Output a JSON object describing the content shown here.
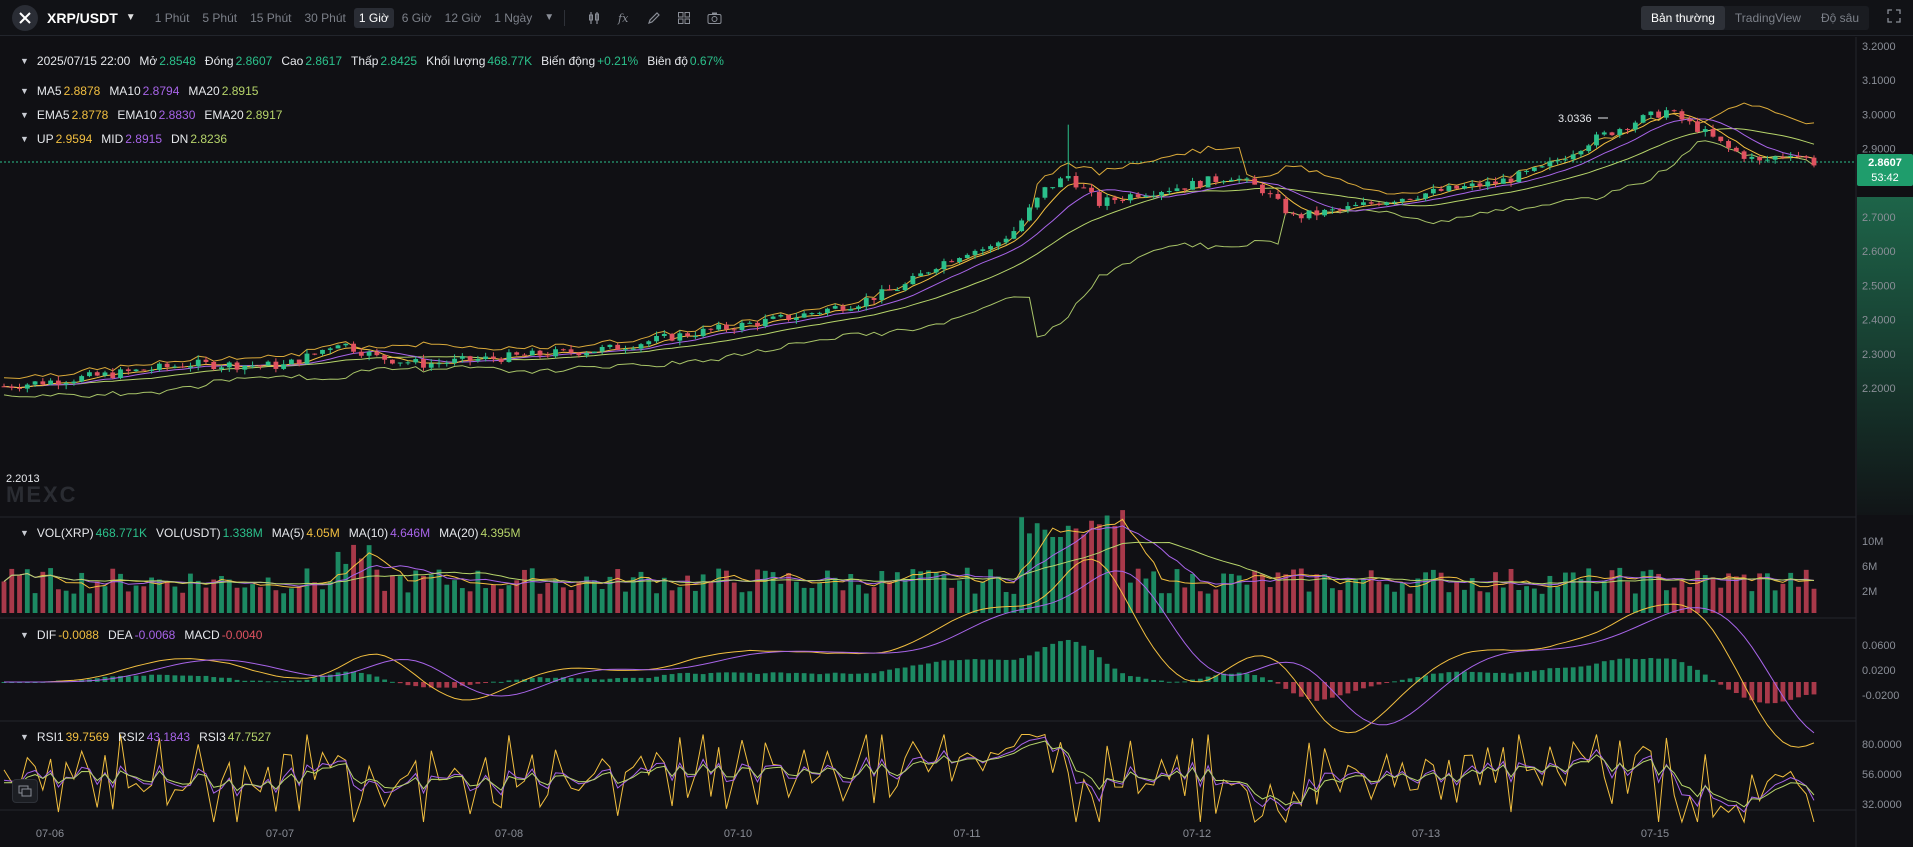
{
  "toolbar": {
    "symbol": "XRP/USDT",
    "intervals": [
      "1 Phút",
      "5 Phút",
      "15 Phút",
      "30 Phút",
      "1 Giờ",
      "6 Giờ",
      "12 Giờ",
      "1 Ngày"
    ],
    "active_interval": "1 Giờ",
    "views": [
      "Bản thường",
      "TradingView",
      "Độ sâu"
    ],
    "active_view": "Bản thường"
  },
  "ohlc": {
    "date": "2025/07/15 22:00",
    "open_label": "Mở",
    "open": "2.8548",
    "close_label": "Đóng",
    "close": "2.8607",
    "high_label": "Cao",
    "high": "2.8617",
    "low_label": "Thấp",
    "low": "2.8425",
    "volume_label": "Khối lượng",
    "volume": "468.77K",
    "change_label": "Biến động",
    "change": "+0.21%",
    "amplitude_label": "Biên độ",
    "amplitude": "0.67%"
  },
  "ma": {
    "ma5_label": "MA5",
    "ma5": "2.8878",
    "ma10_label": "MA10",
    "ma10": "2.8794",
    "ma20_label": "MA20",
    "ma20": "2.8915"
  },
  "ema": {
    "ema5_label": "EMA5",
    "ema5": "2.8778",
    "ema10_label": "EMA10",
    "ema10": "2.8830",
    "ema20_label": "EMA20",
    "ema20": "2.8917"
  },
  "boll": {
    "up_label": "UP",
    "up": "2.9594",
    "mid_label": "MID",
    "mid": "2.8915",
    "dn_label": "DN",
    "dn": "2.8236"
  },
  "vol": {
    "xrp_label": "VOL(XRP)",
    "xrp": "468.771K",
    "usdt_label": "VOL(USDT)",
    "usdt": "1.338M",
    "ma5_label": "MA(5)",
    "ma5": "4.05M",
    "ma10_label": "MA(10)",
    "ma10": "4.646M",
    "ma20_label": "MA(20)",
    "ma20": "4.395M"
  },
  "macd": {
    "dif_label": "DIF",
    "dif": "-0.0088",
    "dea_label": "DEA",
    "dea": "-0.0068",
    "macd_label": "MACD",
    "macd": "-0.0040"
  },
  "rsi": {
    "rsi1_label": "RSI1",
    "rsi1": "39.7569",
    "rsi2_label": "RSI2",
    "rsi2": "43.1843",
    "rsi3_label": "RSI3",
    "rsi3": "47.7527"
  },
  "price_axis": [
    "3.2000",
    "3.1000",
    "3.0000",
    "2.9000",
    "2.7000",
    "2.6000",
    "2.5000",
    "2.4000",
    "2.3000",
    "2.2000"
  ],
  "current_price": "2.8607",
  "countdown": "53:42",
  "high_marker": "3.0336",
  "low_marker": "2.2013",
  "vol_axis": [
    "10M",
    "6M",
    "2M"
  ],
  "macd_axis": [
    "0.0600",
    "0.0200",
    "-0.0200"
  ],
  "rsi_axis": [
    "80.0000",
    "56.0000",
    "32.0000"
  ],
  "time_axis": [
    "07-06",
    "07-07",
    "07-08",
    "07-10",
    "07-11",
    "07-12",
    "07-13",
    "07-15"
  ],
  "watermark": "MEXC",
  "colors": {
    "up": "#2bc08b",
    "down": "#e05260",
    "ma5": "#f2bf40",
    "ma10": "#a764e8",
    "ma20": "#b6d46a",
    "background": "#101014"
  },
  "icons": [
    "close-x-icon",
    "caret-down-icon",
    "candle-settings-icon",
    "formula-icon",
    "pencil-icon",
    "grid-layout-icon",
    "camera-icon",
    "fullscreen-icon",
    "layers-icon"
  ]
}
